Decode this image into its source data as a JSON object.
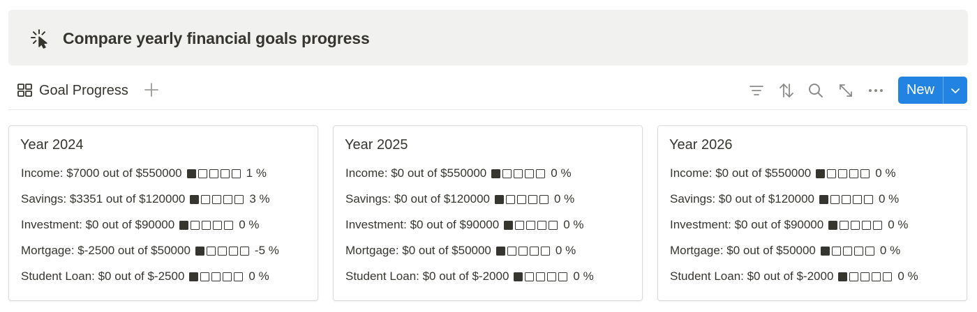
{
  "callout": {
    "icon": "sparkle-cursor-icon",
    "title": "Compare yearly financial goals progress"
  },
  "toolbar": {
    "view_icon": "gallery-grid-icon",
    "view_label": "Goal Progress",
    "icons": [
      "filter-icon",
      "sort-icon",
      "search-icon",
      "expand-icon",
      "more-icon"
    ],
    "new_label": "New",
    "accent": "#2383e2"
  },
  "cards": [
    {
      "title": "Year 2024",
      "rows": [
        {
          "text": "Income: $7000 out of $550000",
          "filled": 1,
          "pct": "1 %"
        },
        {
          "text": "Savings: $3351 out of $120000",
          "filled": 1,
          "pct": "3 %"
        },
        {
          "text": "Investment: $0 out of $90000",
          "filled": 1,
          "pct": "0 %"
        },
        {
          "text": "Mortgage: $-2500 out of $50000",
          "filled": 1,
          "pct": "-5 %"
        },
        {
          "text": "Student Loan: $0 out of $-2500",
          "filled": 1,
          "pct": "0 %"
        }
      ]
    },
    {
      "title": "Year 2025",
      "rows": [
        {
          "text": "Income: $0 out of $550000",
          "filled": 1,
          "pct": "0 %"
        },
        {
          "text": "Savings: $0 out of $120000",
          "filled": 1,
          "pct": "0 %"
        },
        {
          "text": "Investment: $0 out of $90000",
          "filled": 1,
          "pct": "0 %"
        },
        {
          "text": "Mortgage: $0 out of $50000",
          "filled": 1,
          "pct": "0 %"
        },
        {
          "text": "Student Loan: $0 out of $-2000",
          "filled": 1,
          "pct": "0 %"
        }
      ]
    },
    {
      "title": "Year 2026",
      "rows": [
        {
          "text": "Income: $0 out of $550000",
          "filled": 1,
          "pct": "0 %"
        },
        {
          "text": "Savings: $0 out of $120000",
          "filled": 1,
          "pct": "0 %"
        },
        {
          "text": "Investment: $0 out of $90000",
          "filled": 1,
          "pct": "0 %"
        },
        {
          "text": "Mortgage: $0 out of $50000",
          "filled": 1,
          "pct": "0 %"
        },
        {
          "text": "Student Loan: $0 out of $-2000",
          "filled": 1,
          "pct": "0 %"
        }
      ]
    }
  ]
}
